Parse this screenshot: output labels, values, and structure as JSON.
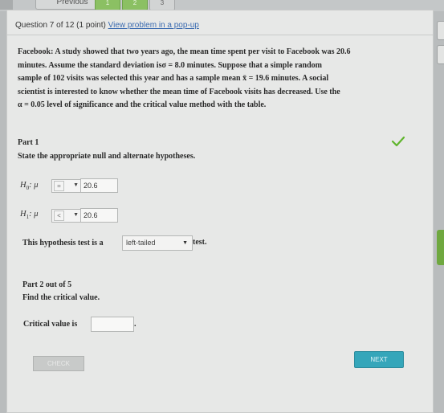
{
  "nav": {
    "previous_label": "Previous",
    "question_tabs": [
      "1",
      "2",
      "3"
    ]
  },
  "header": {
    "question_info": "Question 7 of 12 (1 point)",
    "popup_link": "View problem in a pop-up"
  },
  "problem": {
    "line1": "Facebook: A study showed that two years ago, the mean time spent per visit to Facebook was 20.6",
    "line2": "minutes. Assume the standard deviation isσ = 8.0 minutes. Suppose that a simple random",
    "line3": "sample of 102 visits was selected this year and has a sample mean x̄ = 19.6 minutes. A social",
    "line4": "scientist is interested to know whether the mean time of Facebook visits has decreased. Use the",
    "line5": "α = 0.05 level of significance and the critical value method with the table."
  },
  "part1": {
    "title": "Part 1",
    "instruction": "State the appropriate null and alternate hypotheses.",
    "h0": {
      "symbol": "H",
      "sub": "0",
      "mu": ": μ",
      "operator": "=",
      "value": "20.6"
    },
    "h1": {
      "symbol": "H",
      "sub": "1",
      "mu": ": μ",
      "operator": "<",
      "value": "20.6"
    },
    "test_prefix": "This hypothesis test is a",
    "test_type": "left-tailed",
    "test_suffix": "test."
  },
  "part2": {
    "title": "Part 2 out of 5",
    "instruction": "Find the critical value.",
    "critical_label": "Critical value is",
    "critical_value": "",
    "period": "."
  },
  "buttons": {
    "check": "CHECK",
    "next": "NEXT"
  },
  "colors": {
    "next_button": "#35a6ba",
    "checkmark": "#5fb52c",
    "link": "#3b6bb0",
    "tab_green": "#8bc063"
  }
}
